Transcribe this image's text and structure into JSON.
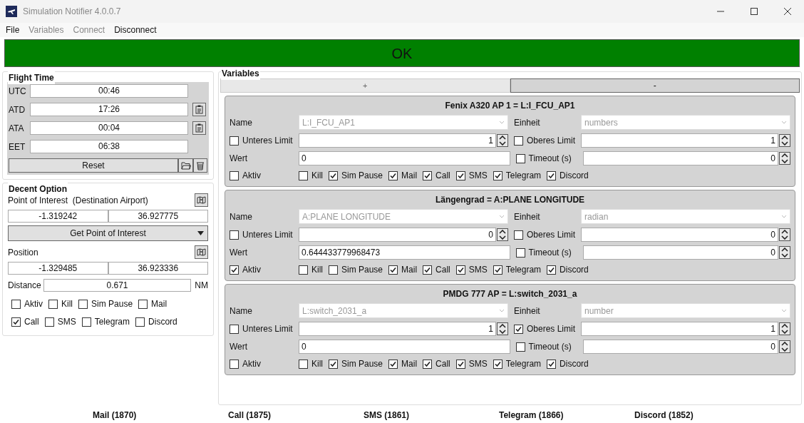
{
  "window": {
    "title": "Simulation Notifier 4.0.0.7"
  },
  "menu": [
    {
      "label": "File",
      "disabled": false
    },
    {
      "label": "Variables",
      "disabled": true
    },
    {
      "label": "Connect",
      "disabled": true
    },
    {
      "label": "Disconnect",
      "disabled": false
    }
  ],
  "status_banner": {
    "text": "OK",
    "color": "#008000"
  },
  "flight_time": {
    "title": "Flight Time",
    "rows": [
      {
        "label": "UTC",
        "value": "00:46",
        "kind": "plain"
      },
      {
        "label": "ATD",
        "value": "17:26",
        "kind": "with_button"
      },
      {
        "label": "ATA",
        "value": "00:04",
        "kind": "with_button"
      },
      {
        "label": "EET",
        "value": "06:38",
        "kind": "plain"
      }
    ],
    "reset_button": "Reset"
  },
  "descent_option": {
    "title": "Decent Option",
    "poi_label": "Point of Interest  (Destination Airport)",
    "poi_values": [
      "-1.319242",
      "36.927775"
    ],
    "poi_dropdown": "Get Point of Interest",
    "position_label": "Position",
    "position_values": [
      "-1.329485",
      "36.923336"
    ],
    "distance_label": "Distance",
    "distance_value": "0.671",
    "distance_unit": "NM",
    "checkboxes": [
      {
        "label": "Aktiv",
        "checked": false
      },
      {
        "label": "Kill",
        "checked": false
      },
      {
        "label": "Sim Pause",
        "checked": false
      },
      {
        "label": "Mail",
        "checked": false
      },
      {
        "label": "Call",
        "checked": true
      },
      {
        "label": "SMS",
        "checked": false
      },
      {
        "label": "Telegram",
        "checked": false
      },
      {
        "label": "Discord",
        "checked": false
      }
    ]
  },
  "variables": {
    "title": "Variables",
    "add_button": "+",
    "remove_button": "-",
    "items": [
      {
        "title": "Fenix A320 AP 1 = L:I_FCU_AP1",
        "name": {
          "label": "Name",
          "value": "L:I_FCU_AP1"
        },
        "unit": {
          "label": "Einheit",
          "value": "numbers"
        },
        "lower_limit": {
          "label": "Unteres Limit",
          "checked": false,
          "value": "1"
        },
        "upper_limit": {
          "label": "Oberes Limit",
          "checked": false,
          "value": "1"
        },
        "value": {
          "label": "Wert",
          "value": "0"
        },
        "timeout": {
          "label": "Timeout (s)",
          "checked": false,
          "value": "0"
        },
        "active": {
          "label": "Aktiv",
          "checked": false
        },
        "notifications": [
          {
            "label": "Kill",
            "checked": false
          },
          {
            "label": "Sim Pause",
            "checked": true
          },
          {
            "label": "Mail",
            "checked": true
          },
          {
            "label": "Call",
            "checked": true
          },
          {
            "label": "SMS",
            "checked": true
          },
          {
            "label": "Telegram",
            "checked": true
          },
          {
            "label": "Discord",
            "checked": true
          }
        ]
      },
      {
        "title": "Längengrad = A:PLANE LONGITUDE",
        "name": {
          "label": "Name",
          "value": "A:PLANE LONGITUDE"
        },
        "unit": {
          "label": "Einheit",
          "value": "radian"
        },
        "lower_limit": {
          "label": "Unteres Limit",
          "checked": false,
          "value": "0"
        },
        "upper_limit": {
          "label": "Oberes Limit",
          "checked": false,
          "value": "0"
        },
        "value": {
          "label": "Wert",
          "value": "0.644433779968473"
        },
        "timeout": {
          "label": "Timeout (s)",
          "checked": false,
          "value": "0"
        },
        "active": {
          "label": "Aktiv",
          "checked": true
        },
        "notifications": [
          {
            "label": "Kill",
            "checked": false
          },
          {
            "label": "Sim Pause",
            "checked": false
          },
          {
            "label": "Mail",
            "checked": true
          },
          {
            "label": "Call",
            "checked": true
          },
          {
            "label": "SMS",
            "checked": true
          },
          {
            "label": "Telegram",
            "checked": true
          },
          {
            "label": "Discord",
            "checked": true
          }
        ]
      },
      {
        "title": "PMDG 777 AP = L:switch_2031_a",
        "name": {
          "label": "Name",
          "value": "L:switch_2031_a"
        },
        "unit": {
          "label": "Einheit",
          "value": "number"
        },
        "lower_limit": {
          "label": "Unteres Limit",
          "checked": false,
          "value": "1"
        },
        "upper_limit": {
          "label": "Oberes Limit",
          "checked": true,
          "value": "1"
        },
        "value": {
          "label": "Wert",
          "value": "0"
        },
        "timeout": {
          "label": "Timeout (s)",
          "checked": false,
          "value": "0"
        },
        "active": {
          "label": "Aktiv",
          "checked": false
        },
        "notifications": [
          {
            "label": "Kill",
            "checked": false
          },
          {
            "label": "Sim Pause",
            "checked": true
          },
          {
            "label": "Mail",
            "checked": true
          },
          {
            "label": "Call",
            "checked": true
          },
          {
            "label": "SMS",
            "checked": true
          },
          {
            "label": "Telegram",
            "checked": true
          },
          {
            "label": "Discord",
            "checked": true
          }
        ]
      }
    ]
  },
  "status_bar": [
    "Mail (1870)",
    "Call (1875)",
    "SMS (1861)",
    "Telegram (1866)",
    "Discord (1852)"
  ]
}
